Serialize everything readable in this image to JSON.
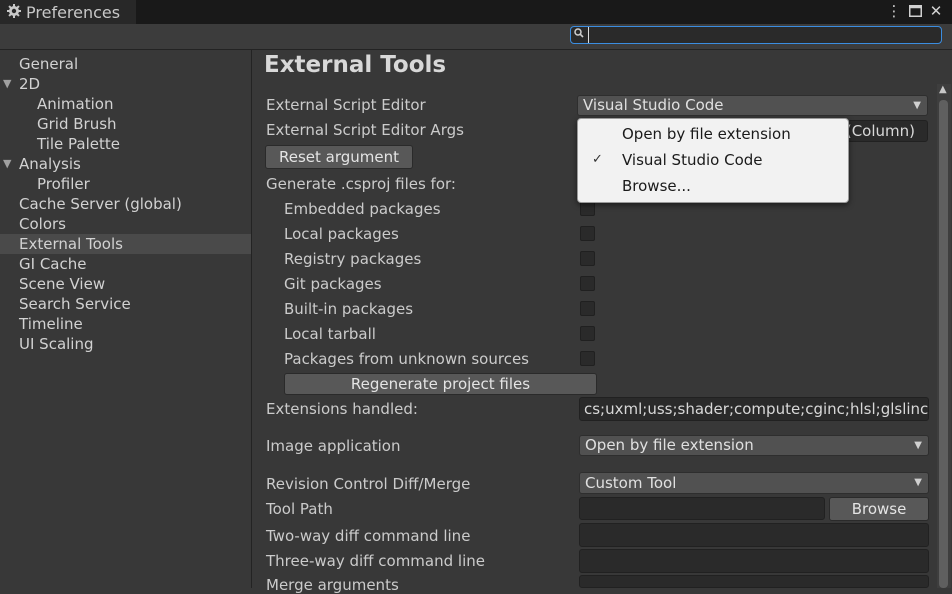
{
  "window": {
    "title": "Preferences",
    "more_icon": "⋮",
    "maximize_icon": "□",
    "close_icon": "✕"
  },
  "search": {
    "placeholder": "",
    "value": ""
  },
  "sidebar": {
    "items": [
      {
        "label": "General"
      },
      {
        "label": "2D",
        "arrow": "▼"
      },
      {
        "label": "Animation"
      },
      {
        "label": "Grid Brush"
      },
      {
        "label": "Tile Palette"
      },
      {
        "label": "Analysis",
        "arrow": "▼"
      },
      {
        "label": "Profiler"
      },
      {
        "label": "Cache Server (global)"
      },
      {
        "label": "Colors"
      },
      {
        "label": "External Tools",
        "selected": true
      },
      {
        "label": "GI Cache"
      },
      {
        "label": "Scene View"
      },
      {
        "label": "Search Service"
      },
      {
        "label": "Timeline"
      },
      {
        "label": "UI Scaling"
      }
    ]
  },
  "main": {
    "title": "External Tools",
    "script_editor": {
      "label": "External Script Editor",
      "value": "Visual Studio Code"
    },
    "script_editor_args": {
      "label": "External Script Editor Args",
      "value_visible": "$(Column)"
    },
    "reset_button": "Reset argument",
    "csproj_label": "Generate .csproj files for:",
    "packages": [
      {
        "label": "Embedded packages",
        "checked": false
      },
      {
        "label": "Local packages",
        "checked": false
      },
      {
        "label": "Registry packages",
        "checked": false
      },
      {
        "label": "Git packages",
        "checked": false
      },
      {
        "label": "Built-in packages",
        "checked": false
      },
      {
        "label": "Local tarball",
        "checked": false
      },
      {
        "label": "Packages from unknown sources",
        "checked": false
      }
    ],
    "regenerate_button": "Regenerate project files",
    "extensions": {
      "label": "Extensions handled:",
      "value": "cs;uxml;uss;shader;compute;cginc;hlsl;glslinc;te"
    },
    "image_app": {
      "label": "Image application",
      "value": "Open by file extension"
    },
    "revision": {
      "label": "Revision Control Diff/Merge",
      "value": "Custom Tool"
    },
    "tool_path": {
      "label": "Tool Path",
      "value": "",
      "browse": "Browse"
    },
    "two_way": {
      "label": "Two-way diff command line",
      "value": ""
    },
    "three_way": {
      "label": "Three-way diff command line",
      "value": ""
    },
    "merge": {
      "label": "Merge arguments",
      "value": ""
    }
  },
  "popup": {
    "items": [
      {
        "label": "Open by file extension",
        "checked": false
      },
      {
        "label": "Visual Studio Code",
        "checked": true,
        "check": "✓"
      },
      {
        "label": "Browse...",
        "checked": false
      }
    ]
  },
  "colors": {
    "accent": "#3b8de0",
    "selection": "#4a4a4a",
    "background": "#383838"
  }
}
